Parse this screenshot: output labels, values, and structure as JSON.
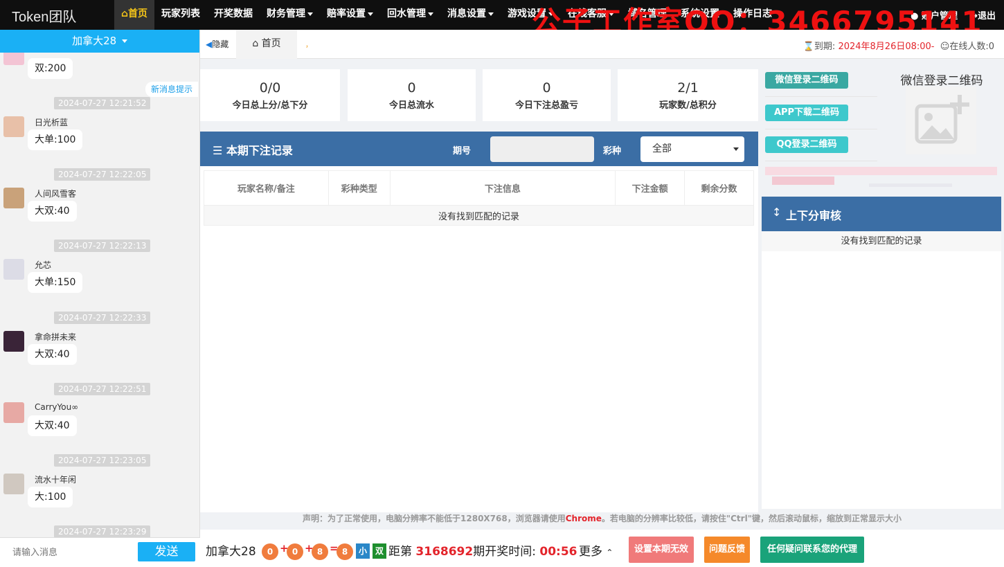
{
  "brand": "Token团队",
  "watermark": "公子工作室QQ：3466795141",
  "nav": {
    "items": [
      {
        "label": "首页",
        "active": true,
        "dropdown": false,
        "icon": "home-icon"
      },
      {
        "label": "玩家列表",
        "dropdown": false
      },
      {
        "label": "开奖数据",
        "dropdown": false
      },
      {
        "label": "财务管理",
        "dropdown": true
      },
      {
        "label": "赔率设置",
        "dropdown": true
      },
      {
        "label": "回水管理",
        "dropdown": true
      },
      {
        "label": "消息设置",
        "dropdown": true
      },
      {
        "label": "游戏设置",
        "dropdown": true
      },
      {
        "label": "在线客服",
        "dropdown": true
      },
      {
        "label": "域名管理",
        "dropdown": false
      },
      {
        "label": "系统设置",
        "dropdown": false
      },
      {
        "label": "操作日志",
        "dropdown": false
      }
    ],
    "account": "账户管理",
    "logout": "退出"
  },
  "chat": {
    "room": "加拿大28",
    "new_message_hint": "新消息提示",
    "partial_top_bubble": "双:200",
    "messages": [
      {
        "time": "2024-07-27 12:21:52",
        "user": "日光析蓝",
        "text": "大单:100"
      },
      {
        "time": "2024-07-27 12:22:05",
        "user": "人间风雪客",
        "text": "大双:40"
      },
      {
        "time": "2024-07-27 12:22:13",
        "user": "允芯",
        "text": "大单:150"
      },
      {
        "time": "2024-07-27 12:22:33",
        "user": "拿命拼未来",
        "text": "大双:40"
      },
      {
        "time": "2024-07-27 12:22:51",
        "user": "CarryYou∞",
        "text": "大双:40"
      },
      {
        "time": "2024-07-27 12:23:05",
        "user": "流水十年闲",
        "text": "大:100"
      },
      {
        "time": "2024-07-27 12:23:29",
        "user": "",
        "text": ""
      }
    ],
    "input_placeholder": "请输入消息",
    "send_label": "发送"
  },
  "tabbar": {
    "hide_label": "隐藏",
    "home_tab": "首页",
    "dot": "，",
    "expire_label": "到期:",
    "expire_value": "2024年8月26日08:00-",
    "online_label": "在线人数:",
    "online_value": "0"
  },
  "stats": [
    {
      "value": "0/0",
      "label": "今日总上分/总下分"
    },
    {
      "value": "0",
      "label": "今日总流水"
    },
    {
      "value": "0",
      "label": "今日下注总盈亏"
    },
    {
      "value": "2/1",
      "label": "玩家数/总积分"
    }
  ],
  "bets": {
    "title": "本期下注记录",
    "issue_label": "期号",
    "issue_value": "",
    "type_label": "彩种",
    "type_value": "全部",
    "columns": [
      "玩家名称/备注",
      "彩种类型",
      "下注信息",
      "下注金额",
      "剩余分数"
    ],
    "empty": "没有找到匹配的记录"
  },
  "qr": {
    "buttons": [
      {
        "label": "微信登录二维码",
        "color": "#3aa8a2"
      },
      {
        "label": "APP下载二维码",
        "color": "#3ec8cc"
      },
      {
        "label": "QQ登录二维码",
        "color": "#3ec8cc"
      }
    ],
    "title": "微信登录二维码"
  },
  "audit": {
    "title": "上下分审核",
    "empty": "没有找到匹配的记录"
  },
  "notice": {
    "before": "声明：为了正常使用，电脑分辨率不能低于1280X768，浏览器请使用",
    "browser": "Chrome",
    "after": "。若电脑的分辨率比较低，请按住\"Ctrl\"键，然后滚动鼠标，缩放到正常显示大小"
  },
  "draw": {
    "room": "加拿大28",
    "balls": [
      "0",
      "0",
      "8"
    ],
    "plus": "+",
    "equals": "=",
    "sum": "8",
    "size_tag": "小",
    "parity_tag": "双",
    "prefix": "距第",
    "issue": "3168692",
    "suffix": "期开奖时间:",
    "countdown": "00:56",
    "more": "更多"
  },
  "bottom_buttons": [
    {
      "label": "设置本期无效",
      "color": "#f07a7a"
    },
    {
      "label": "问题反馈",
      "color": "#f5892a"
    },
    {
      "label": "任何疑问联系您的代理",
      "color": "#1aa37a"
    }
  ],
  "colors": {
    "accent": "#1ab0f5",
    "panel_header": "#3b6ea5",
    "topbar": "#0f0f0f",
    "danger": "#e3242b"
  }
}
